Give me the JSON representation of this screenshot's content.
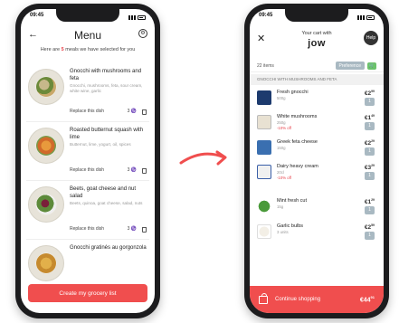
{
  "left_phone": {
    "status": {
      "time": "09:45"
    },
    "header": {
      "title": "Menu"
    },
    "subtitle": {
      "pre": "Here are ",
      "count": "5",
      "post": " meals we have selected for you"
    },
    "meals": [
      {
        "name": "Gnocchi with mushrooms and feta",
        "desc": "Gnocchi, mushrooms, feta, sour cream, white wine, garlic",
        "replace": "Replace this dish",
        "servings": "3 ♑"
      },
      {
        "name": "Roasted butternut squash with lime",
        "desc": "Butternut, lime, yogurt, oil, spices",
        "replace": "Replace this dish",
        "servings": "3 ♑"
      },
      {
        "name": "Beets, goat cheese and nut salad",
        "desc": "Beets, quinoa, goat cheese, salad, nuts",
        "replace": "Replace this dish",
        "servings": "3 ♑"
      },
      {
        "name": "Gnocchi gratinés au gorgonzola",
        "desc": "",
        "replace": "",
        "servings": ""
      }
    ],
    "cta": {
      "label": "Create my grocery list"
    }
  },
  "right_phone": {
    "status": {
      "time": "09:45"
    },
    "header": {
      "title": "Your cart with",
      "logo": "jow",
      "help": "Help"
    },
    "toolbar": {
      "items": "22 items",
      "preference": "Preference"
    },
    "section": {
      "label": "Gnocchi with mushrooms and feta"
    },
    "products": [
      {
        "name": "Fresh gnocchi",
        "sub": "500g",
        "note": "",
        "price": "€2",
        "cents": "99",
        "qty": "1"
      },
      {
        "name": "White mushrooms",
        "sub": "250g",
        "note": "-10% off",
        "price": "€1",
        "cents": "49",
        "qty": "1"
      },
      {
        "name": "Greek feta cheese",
        "sub": "150g",
        "note": "",
        "price": "€2",
        "cents": "29",
        "qty": "1"
      },
      {
        "name": "Dairy heavy cream",
        "sub": "20cl",
        "note": "-10% off",
        "price": "€3",
        "cents": "29",
        "qty": "1"
      },
      {
        "name": "Mint fresh cut",
        "sub": "15g",
        "note": "",
        "price": "€1",
        "cents": "29",
        "qty": "1"
      },
      {
        "name": "Garlic bulbs",
        "sub": "3 units",
        "note": "",
        "price": "€2",
        "cents": "59",
        "qty": "1"
      }
    ],
    "cta": {
      "label": "Continue shopping",
      "total": "€44",
      "total_cents": "91"
    }
  },
  "colors": {
    "accent": "#f04e4e",
    "qty": "#a9b9c2",
    "green": "#6cc36c"
  }
}
